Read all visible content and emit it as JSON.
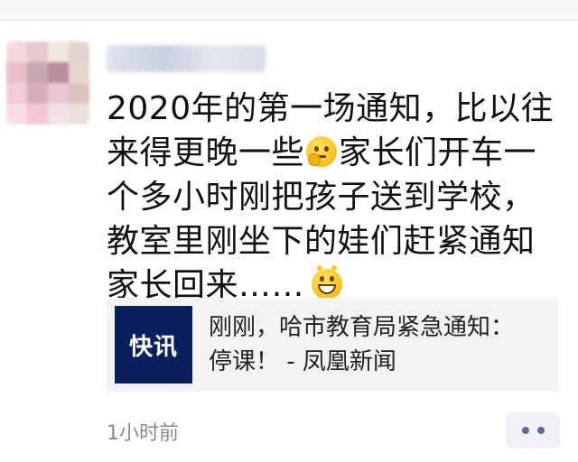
{
  "post": {
    "line1": "2020年的第一场通知，比以往",
    "line2_a": "来得更晚一些",
    "line2_emoji": "thinking-face-emoji",
    "line2_b": "家长们开车一",
    "line3": "个多小时刚把孩子送到学校，",
    "line4": "教室里刚坐下的娃们赶紧通知",
    "line5": "家长回来……",
    "line5_emoji": "grinning-face-emoji"
  },
  "link_card": {
    "thumbnail_text": "快讯",
    "title_line1": "刚刚，哈市教育局紧急通知：",
    "title_line2": "停课！ - 凤凰新闻"
  },
  "meta": {
    "timestamp": "1小时前",
    "more_icon": "more-dots-icon"
  },
  "colors": {
    "thumbnail_bg": "#0a1f5c",
    "card_bg": "#f3f3f5",
    "timestamp": "#8a8a8a",
    "more_dots": "#5b6b95"
  }
}
